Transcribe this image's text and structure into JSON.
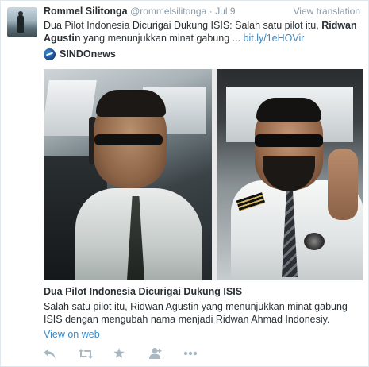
{
  "tweet": {
    "name": "Rommel Silitonga",
    "handle": "@rommelsilitonga",
    "separator": "·",
    "date": "Jul 9",
    "view_translation": "View translation",
    "text_part1": "Dua Pilot Indonesia Dicurigai Dukung ISIS: Salah satu pilot itu, ",
    "text_bold": "Ridwan Agustin",
    "text_part2": " yang menunjukkan minat gabung ... ",
    "link": "bit.ly/1eHOVir"
  },
  "source": {
    "name": "SINDOnews"
  },
  "card": {
    "title": "Dua Pilot Indonesia Dicurigai Dukung ISIS",
    "description": "Salah satu pilot itu, Ridwan Agustin yang menunjukkan minat gabung ISIS dengan mengubah nama menjadi Ridwan Ahmad Indonesiy.",
    "view_on_web": "View on web"
  },
  "actions": [
    {
      "icon": "reply-icon"
    },
    {
      "icon": "retweet-icon"
    },
    {
      "icon": "favorite-star-icon"
    },
    {
      "icon": "follow-user-icon"
    },
    {
      "icon": "more-icon"
    }
  ],
  "colors": {
    "link": "#3b88c3",
    "muted": "#8899a6",
    "action_icon": "#aab8c2",
    "text": "#292f33"
  }
}
